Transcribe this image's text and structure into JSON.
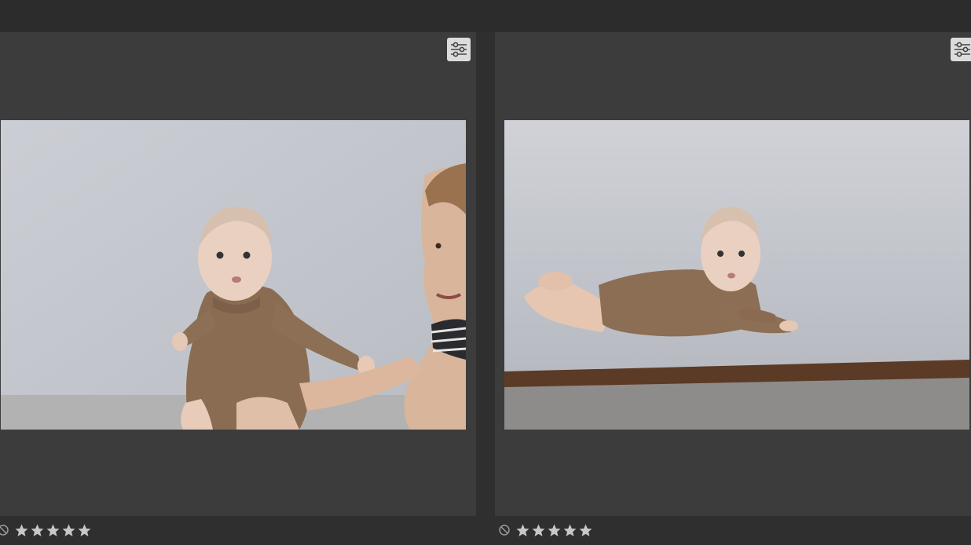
{
  "colors": {
    "background": "#2f2f2f",
    "cell": "#3c3c3c",
    "star": "#c8c8c8",
    "reject": "#9a9a9a"
  },
  "thumbnails": [
    {
      "photo": "baby-sitting-with-mother",
      "rating": 0,
      "max_rating": 5,
      "has_adjustments": true,
      "reject_icon": "reject-icon",
      "adjust_icon": "sliders-icon"
    },
    {
      "photo": "baby-lying-on-stomach",
      "rating": 0,
      "max_rating": 5,
      "has_adjustments": true,
      "reject_icon": "reject-icon",
      "adjust_icon": "sliders-icon"
    }
  ]
}
